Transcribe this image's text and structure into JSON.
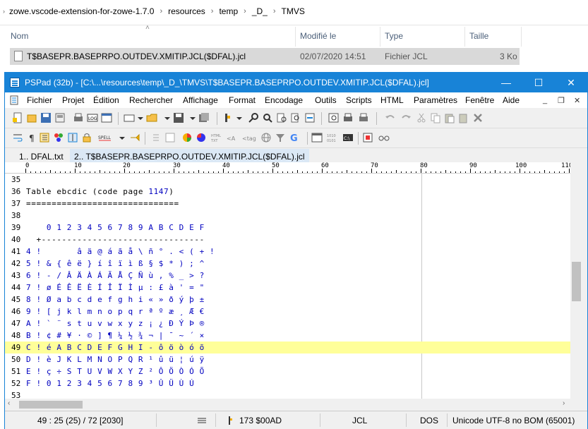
{
  "breadcrumb": [
    "zowe.vscode-extension-for-zowe-1.7.0",
    "resources",
    "temp",
    "_D_",
    "TMVS"
  ],
  "columns": {
    "name": "Nom",
    "modified": "Modifié le",
    "type": "Type",
    "size": "Taille"
  },
  "file": {
    "name": "T$BASEPR.BASEPRPO.OUTDEV.XMITIP.JCL($DFAL).jcl",
    "modified": "02/07/2020 14:51",
    "type": "Fichier JCL",
    "size": "3 Ko"
  },
  "window": {
    "title": "PSPad (32b) - [C:\\...\\resources\\temp\\_D_\\TMVS\\T$BASEPR.BASEPRPO.OUTDEV.XMITIP.JCL($DFAL).jcl]"
  },
  "menu": [
    "Fichier",
    "Projet",
    "Édition",
    "Rechercher",
    "Affichage",
    "Format",
    "Encodage",
    "Outils",
    "Scripts",
    "HTML",
    "Paramètres",
    "Fenêtre",
    "Aide"
  ],
  "tabs": [
    {
      "label": "1.. DFAL.txt"
    },
    {
      "label": "2.. T$BASEPR.BASEPRPO.OUTDEV.XMITIP.JCL($DFAL).jcl"
    }
  ],
  "ruler": [
    "0",
    "10",
    "20",
    "30",
    "40",
    "50",
    "60",
    "70",
    "80",
    "90",
    "100",
    "110"
  ],
  "lines": [
    {
      "n": "35",
      "text": ""
    },
    {
      "n": "36",
      "text": "Table ebcdic (code page ",
      "extra": "1147",
      "after": ")"
    },
    {
      "n": "37",
      "text": "=============================="
    },
    {
      "n": "38",
      "text": ""
    },
    {
      "n": "39",
      "text": "    0 1 2 3 4 5 6 7 8 9 A B C D E F"
    },
    {
      "n": "40",
      "text": "  +--------------------------------"
    },
    {
      "n": "41",
      "text": "4 !       â ä @ á ã å \\ ñ ° . < ( + !"
    },
    {
      "n": "42",
      "text": "5 ! & { ê ë } í î ï ì ß § $ * ) ; ^"
    },
    {
      "n": "43",
      "text": "6 ! - / Â Ä À Á Ã Å Ç Ñ ù , % _ > ?"
    },
    {
      "n": "44",
      "text": "7 ! ø É Ê Ë È Í Î Ï Ì µ : £ à ' = \""
    },
    {
      "n": "45",
      "text": "8 ! Ø a b c d e f g h i « » ð ý þ ±"
    },
    {
      "n": "46",
      "text": "9 ! [ j k l m n o p q r ª º æ ¸ Æ €"
    },
    {
      "n": "47",
      "text": "A ! ` ¨ s t u v w x y z ¡ ¿ Ð Ý Þ ®"
    },
    {
      "n": "48",
      "text": "B ! ¢ # ¥ · © ] ¶ ¼ ½ ¾ ¬ | ¯ ~ ´ ×"
    },
    {
      "n": "49",
      "text": "C ! é A B C D E F G H I - ô ö ò ó õ"
    },
    {
      "n": "50",
      "text": "D ! è J K L M N O P Q R ¹ û ü ¦ ú ÿ"
    },
    {
      "n": "51",
      "text": "E ! ç ÷ S T U V W X Y Z ² Ô Ö Ò Ó Õ"
    },
    {
      "n": "52",
      "text": "F ! 0 1 2 3 4 5 6 7 8 9 ³ Û Ü Ù Ú"
    },
    {
      "n": "53",
      "text": ""
    }
  ],
  "status": {
    "pos": "49 : 25 (25) / 72  [2030]",
    "char": "173  $00AD",
    "lang": "JCL",
    "eol": "DOS",
    "enc": "Unicode UTF-8 no BOM (65001)"
  },
  "colors": {
    "accent": "#1883d7",
    "current_line": "#ffff99",
    "number": "#0000c0"
  }
}
